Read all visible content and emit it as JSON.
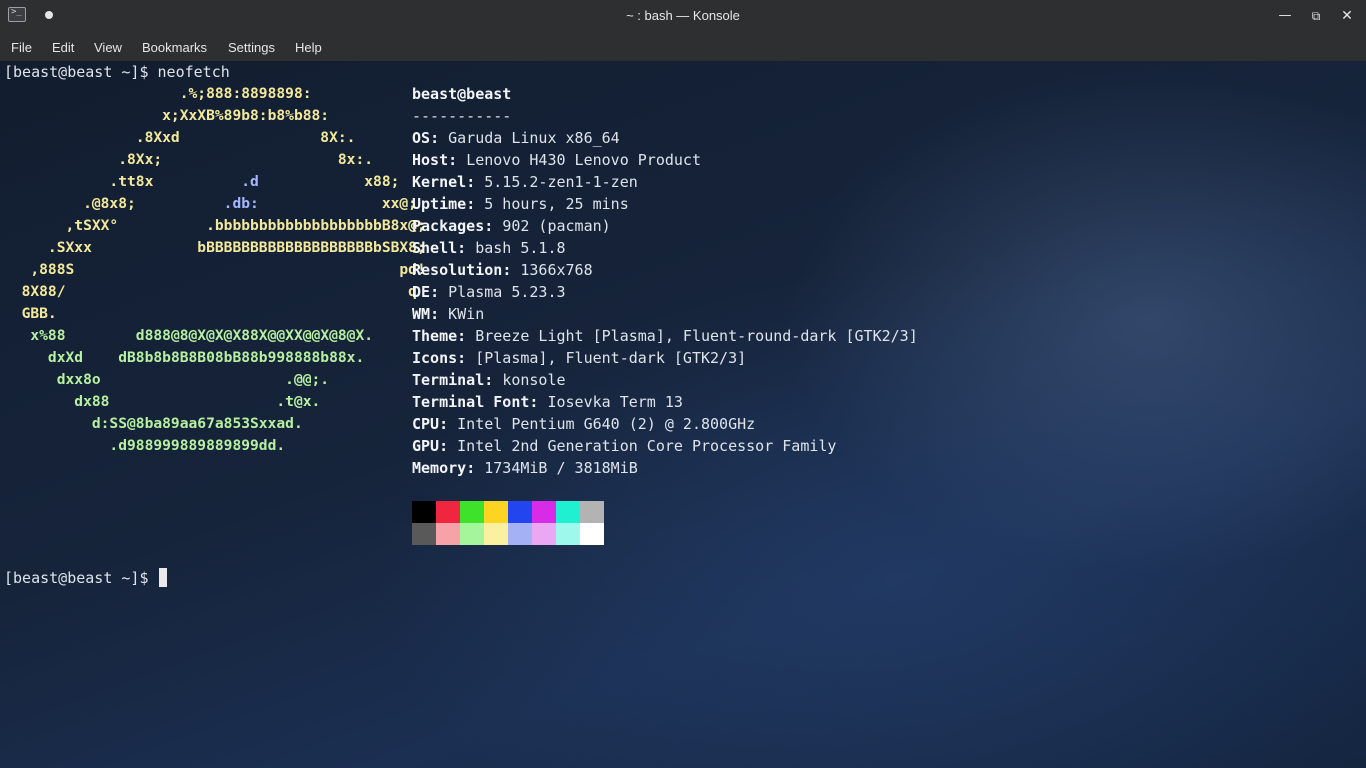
{
  "window": {
    "title": "~ : bash — Konsole",
    "app_icon": "terminal-icon",
    "buttons": {
      "minimize": "—",
      "maximize": "⧉",
      "close": "✕"
    }
  },
  "menu": [
    "File",
    "Edit",
    "View",
    "Bookmarks",
    "Settings",
    "Help"
  ],
  "terminal": {
    "prompt1": "[beast@beast ~]$ neofetch",
    "prompt2": "[beast@beast ~]$ ",
    "logo": [
      {
        "segments": [
          {
            "text": "                    .%;888:8898898:",
            "color": "yellow"
          }
        ]
      },
      {
        "segments": [
          {
            "text": "                  x;XxXB%89b8:b8%b88:",
            "color": "yellow"
          }
        ]
      },
      {
        "segments": [
          {
            "text": "               .8Xxd                8X:.",
            "color": "yellow"
          }
        ]
      },
      {
        "segments": [
          {
            "text": "             .8Xx;                    8x:.",
            "color": "yellow"
          }
        ]
      },
      {
        "segments": [
          {
            "text": "            .tt8x",
            "color": "yellow"
          },
          {
            "text": "          .d",
            "color": "blue"
          },
          {
            "text": "            x88;",
            "color": "yellow"
          }
        ]
      },
      {
        "segments": [
          {
            "text": "         .@8x8;",
            "color": "yellow"
          },
          {
            "text": "          .db:",
            "color": "blue"
          },
          {
            "text": "              xx@;",
            "color": "yellow"
          }
        ]
      },
      {
        "segments": [
          {
            "text": "       ,tSXX°",
            "color": "yellow"
          },
          {
            "text": "          .bbbbbbbbbbbbbbbbbbbB8x@;",
            "color": "yellow"
          }
        ]
      },
      {
        "segments": [
          {
            "text": "     .SXxx",
            "color": "yellow"
          },
          {
            "text": "            bBBBBBBBBBBBBBBBBBBBbSBX8;",
            "color": "yellow"
          }
        ]
      },
      {
        "segments": [
          {
            "text": "   ,888S",
            "color": "yellow"
          },
          {
            "text": "                                     pd!",
            "color": "yellow"
          }
        ]
      },
      {
        "segments": [
          {
            "text": "  8X88/",
            "color": "yellow"
          },
          {
            "text": "                                       q",
            "color": "yellow"
          }
        ]
      },
      {
        "segments": [
          {
            "text": "  GBB.",
            "color": "yellow"
          }
        ]
      },
      {
        "segments": [
          {
            "text": "   x%88",
            "color": "green"
          },
          {
            "text": "        d888@8@X@X@X88X@@XX@@X@8@X.",
            "color": "green"
          }
        ]
      },
      {
        "segments": [
          {
            "text": "     dxXd",
            "color": "green"
          },
          {
            "text": "    dB8b8b8B8B08bB88b998888b88x.",
            "color": "green"
          }
        ]
      },
      {
        "segments": [
          {
            "text": "      dxx8o",
            "color": "green"
          },
          {
            "text": "                     .@@;.",
            "color": "green"
          }
        ]
      },
      {
        "segments": [
          {
            "text": "        dx88",
            "color": "green"
          },
          {
            "text": "                   .t@x.",
            "color": "green"
          }
        ]
      },
      {
        "segments": [
          {
            "text": "          d:SS@8ba89aa67a853Sxxad.",
            "color": "green"
          }
        ]
      },
      {
        "segments": [
          {
            "text": "            .d988999889889899dd.",
            "color": "green"
          }
        ]
      }
    ],
    "info": {
      "user_host": "beast@beast",
      "separator": "-----------",
      "fields": [
        {
          "key": "OS",
          "value": "Garuda Linux x86_64"
        },
        {
          "key": "Host",
          "value": "Lenovo H430 Lenovo Product"
        },
        {
          "key": "Kernel",
          "value": "5.15.2-zen1-1-zen"
        },
        {
          "key": "Uptime",
          "value": "5 hours, 25 mins"
        },
        {
          "key": "Packages",
          "value": "902 (pacman)"
        },
        {
          "key": "Shell",
          "value": "bash 5.1.8"
        },
        {
          "key": "Resolution",
          "value": "1366x768"
        },
        {
          "key": "DE",
          "value": "Plasma 5.23.3"
        },
        {
          "key": "WM",
          "value": "KWin"
        },
        {
          "key": "Theme",
          "value": "Breeze Light [Plasma], Fluent-round-dark [GTK2/3]"
        },
        {
          "key": "Icons",
          "value": "[Plasma], Fluent-dark [GTK2/3]"
        },
        {
          "key": "Terminal",
          "value": "konsole"
        },
        {
          "key": "Terminal Font",
          "value": "Iosevka Term 13"
        },
        {
          "key": "CPU",
          "value": "Intel Pentium G640 (2) @ 2.800GHz"
        },
        {
          "key": "GPU",
          "value": "Intel 2nd Generation Core Processor Family"
        },
        {
          "key": "Memory",
          "value": "1734MiB / 3818MiB"
        }
      ]
    },
    "palette": {
      "normal": [
        "#000000",
        "#f0253f",
        "#3fe22a",
        "#fbd522",
        "#2345f0",
        "#d72be8",
        "#1ff0d2",
        "#b3b3b3"
      ],
      "bright": [
        "#595959",
        "#f6a2a8",
        "#a5f69a",
        "#fbf0a0",
        "#a4b1f5",
        "#eba7f3",
        "#9ef8ec",
        "#ffffff"
      ]
    },
    "colors": {
      "yellow": "#f4e99b",
      "blue": "#a6b7ff",
      "green": "#b6f0a0"
    }
  }
}
